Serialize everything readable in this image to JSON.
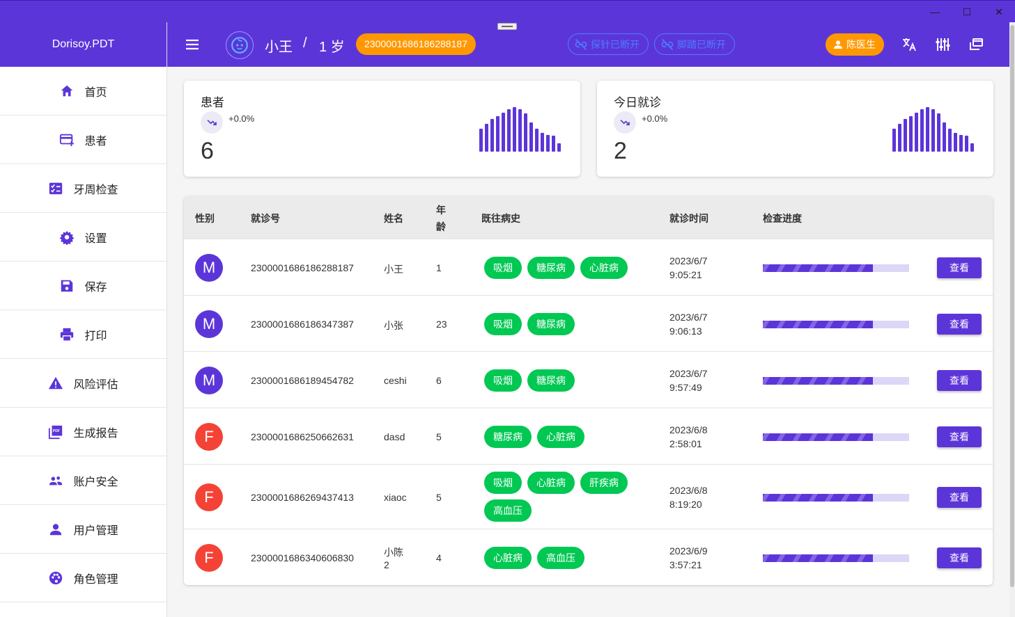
{
  "window": {
    "minimize": "—",
    "maximize": "☐",
    "close": "✕"
  },
  "sidebar": {
    "brand": "Dorisoy.PDT",
    "items": [
      {
        "label": "首页",
        "icon": "home-icon"
      },
      {
        "label": "患者",
        "icon": "patient-card-icon"
      },
      {
        "label": "牙周检查",
        "icon": "checklist-icon"
      },
      {
        "label": "设置",
        "icon": "gear-icon"
      },
      {
        "label": "保存",
        "icon": "save-icon"
      },
      {
        "label": "打印",
        "icon": "printer-icon"
      },
      {
        "label": "风险评估",
        "icon": "warning-icon"
      },
      {
        "label": "生成报告",
        "icon": "pdf-icon"
      },
      {
        "label": "账户安全",
        "icon": "group-icon"
      },
      {
        "label": "用户管理",
        "icon": "user-icon"
      },
      {
        "label": "角色管理",
        "icon": "palette-icon"
      }
    ]
  },
  "header": {
    "patient_name": "小王",
    "separator": "/",
    "patient_age": "1 岁",
    "patient_id": "2300001686186288187",
    "probe_status": "探针已断开",
    "pedal_status": "脚踏已断开",
    "doctor": "陈医生"
  },
  "cards": [
    {
      "title": "患者",
      "change": "+0.0%",
      "value": "6",
      "bars": [
        0.52,
        0.62,
        0.74,
        0.8,
        0.88,
        0.96,
        1.0,
        0.96,
        0.86,
        0.66,
        0.52,
        0.42,
        0.38,
        0.36,
        0.18
      ]
    },
    {
      "title": "今日就诊",
      "change": "+0.0%",
      "value": "2",
      "bars": [
        0.52,
        0.62,
        0.74,
        0.8,
        0.88,
        0.96,
        1.0,
        0.96,
        0.86,
        0.66,
        0.52,
        0.42,
        0.38,
        0.36,
        0.18
      ]
    }
  ],
  "table": {
    "headers": {
      "gender": "性别",
      "visit_no": "就诊号",
      "name": "姓名",
      "age_1": "年",
      "age_2": "龄",
      "history": "既往病史",
      "time": "就诊时间",
      "progress": "检查进度"
    },
    "rows": [
      {
        "gender": "M",
        "visit_no": "2300001686186288187",
        "name_1": "小王",
        "name_2": "",
        "age": "1",
        "history": [
          "吸烟",
          "糖尿病",
          "心脏病"
        ],
        "date": "2023/6/7",
        "time": "9:05:21",
        "progress": 0.75,
        "action": "查看"
      },
      {
        "gender": "M",
        "visit_no": "2300001686186347387",
        "name_1": "小张",
        "name_2": "",
        "age": "23",
        "history": [
          "吸烟",
          "糖尿病"
        ],
        "date": "2023/6/7",
        "time": "9:06:13",
        "progress": 0.75,
        "action": "查看"
      },
      {
        "gender": "M",
        "visit_no": "2300001686189454782",
        "name_1": "ceshi",
        "name_2": "",
        "age": "6",
        "history": [
          "吸烟",
          "糖尿病"
        ],
        "date": "2023/6/7",
        "time": "9:57:49",
        "progress": 0.75,
        "action": "查看"
      },
      {
        "gender": "F",
        "visit_no": "2300001686250662631",
        "name_1": "dasd",
        "name_2": "",
        "age": "5",
        "history": [
          "糖尿病",
          "心脏病"
        ],
        "date": "2023/6/8",
        "time": "2:58:01",
        "progress": 0.75,
        "action": "查看"
      },
      {
        "gender": "F",
        "visit_no": "2300001686269437413",
        "name_1": "xiaoc",
        "name_2": "",
        "age": "5",
        "history": [
          "吸烟",
          "心脏病",
          "肝疾病",
          "高血压"
        ],
        "date": "2023/6/8",
        "time": "8:19:20",
        "progress": 0.75,
        "action": "查看"
      },
      {
        "gender": "F",
        "visit_no": "2300001686340606830",
        "name_1": "小陈",
        "name_2": "2",
        "age": "4",
        "history": [
          "心脏病",
          "高血压"
        ],
        "date": "2023/6/9",
        "time": "3:57:21",
        "progress": 0.75,
        "action": "查看"
      }
    ]
  },
  "colors": {
    "primary": "#5c35d9",
    "orange": "#ff9800",
    "chip_green": "#00c853",
    "male": "#5c35d9",
    "female": "#f44336",
    "disconnected": "#4d7cff"
  }
}
